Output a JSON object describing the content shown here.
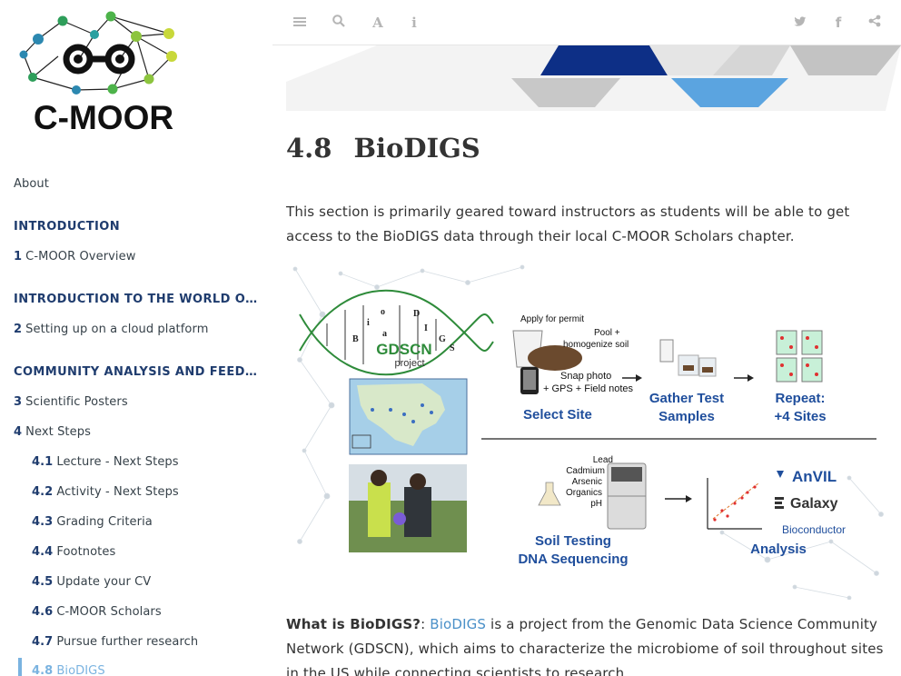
{
  "brand": {
    "logo_text": "C-MOOR"
  },
  "sidebar": {
    "about": "About",
    "parts": [
      {
        "label": "INTRODUCTION"
      },
      {
        "label": "INTRODUCTION TO THE WORLD OF RESEARCH"
      },
      {
        "label": "COMMUNITY ANALYSIS AND FEEDBACK"
      }
    ],
    "chapters": [
      {
        "num": "1",
        "label": "C-MOOR Overview"
      },
      {
        "num": "2",
        "label": "Setting up on a cloud platform"
      },
      {
        "num": "3",
        "label": "Scientific Posters"
      },
      {
        "num": "4",
        "label": "Next Steps"
      }
    ],
    "subsections": [
      {
        "num": "4.1",
        "label": "Lecture - Next Steps"
      },
      {
        "num": "4.2",
        "label": "Activity - Next Steps"
      },
      {
        "num": "4.3",
        "label": "Grading Criteria"
      },
      {
        "num": "4.4",
        "label": "Footnotes"
      },
      {
        "num": "4.5",
        "label": "Update your CV"
      },
      {
        "num": "4.6",
        "label": "C-MOOR Scholars"
      },
      {
        "num": "4.7",
        "label": "Pursue further research"
      },
      {
        "num": "4.8",
        "label": "BioDIGS"
      }
    ]
  },
  "toolbar": {
    "icons": [
      "toggle-sidebar-icon",
      "search-icon",
      "font-settings-icon",
      "info-icon",
      "twitter-icon",
      "facebook-icon",
      "share-icon"
    ]
  },
  "page": {
    "section_number": "4.8",
    "section_title": "BioDIGS",
    "intro": "This section is primarily geared toward instructors as students will be able to get access to the BioDIGS data through their local C-MOOR Scholars chapter.",
    "what_is_label": "What is BioDIGS?",
    "what_is_sep": ": ",
    "what_is_link": "BioDIGS",
    "what_is_text": " is a project from the Genomic Data Science Community Network (GDSCN), which aims to characterize the microbiome of soil throughout sites in the US while connecting scientists to research."
  },
  "figure": {
    "helix_letters": [
      "B",
      "i",
      "o",
      "D",
      "I",
      "G",
      "S"
    ],
    "helix_a": "a",
    "gdscn": "GDSCN",
    "project": "project",
    "apply": "Apply for permit",
    "pool_1": "Pool +",
    "pool_2": "homogenize soil",
    "snap_1": "Snap photo",
    "snap_2": "+ GPS + Field notes",
    "select_site": "Select Site",
    "gather_1": "Gather Test",
    "gather_2": "Samples",
    "repeat_1": "Repeat:",
    "repeat_2": "+4 Sites",
    "lead": "Lead",
    "cadmium": "Cadmium",
    "arsenic": "Arsenic",
    "organics": "Organics",
    "ph": "pH",
    "soil_testing": "Soil Testing",
    "dna_seq": "DNA Sequencing",
    "analysis": "Analysis",
    "anvil": "AnVIL",
    "galaxy": "Galaxy",
    "bioconductor": "Bioconductor"
  },
  "colors": {
    "accent": "#1f3c6e",
    "link": "#4a90c8",
    "active": "#7ab3e0",
    "figure_blue": "#1f4e9c",
    "helix_green": "#2e8b3a"
  }
}
